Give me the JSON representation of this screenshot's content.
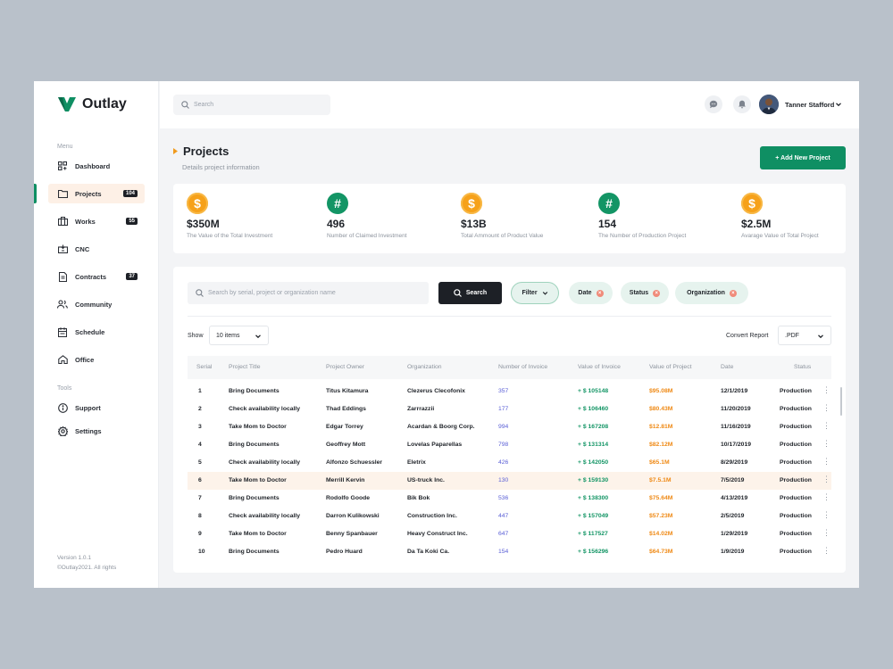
{
  "brand": {
    "name": "Outlay",
    "color": "#0f8f63"
  },
  "sidebar": {
    "menu_label": "Menu",
    "tools_label": "Tools",
    "items": [
      {
        "label": "Dashboard",
        "icon": "dashboard-icon"
      },
      {
        "label": "Projects",
        "icon": "folder-icon",
        "badge": "104",
        "active": true
      },
      {
        "label": "Works",
        "icon": "briefcase-icon",
        "badge": "55"
      },
      {
        "label": "CNC",
        "icon": "cnc-icon"
      },
      {
        "label": "Contracts",
        "icon": "document-icon",
        "badge": "37"
      },
      {
        "label": "Community",
        "icon": "users-icon"
      },
      {
        "label": "Schedule",
        "icon": "calendar-icon"
      },
      {
        "label": "Office",
        "icon": "home-icon"
      }
    ],
    "tools": [
      {
        "label": "Support",
        "icon": "info-icon"
      },
      {
        "label": "Settings",
        "icon": "gear-icon"
      }
    ],
    "version": "Version 1.0.1",
    "copyright": "©Outlay2021. All rights"
  },
  "topbar": {
    "search_placeholder": "Search",
    "user_name": "Tanner Stafford"
  },
  "page": {
    "title": "Projects",
    "subtitle": "Details project information",
    "add_button": "+ Add New Project"
  },
  "stats": [
    {
      "icon": "dollar-icon",
      "symbol": "$",
      "value": "$350M",
      "label": "The Value of the Total Investment"
    },
    {
      "icon": "hash-icon",
      "symbol": "#",
      "value": "496",
      "label": "Number of Claimed Investment"
    },
    {
      "icon": "dollar-icon",
      "symbol": "$",
      "value": "$13B",
      "label": "Total Ammount of Product Value"
    },
    {
      "icon": "hash-icon",
      "symbol": "#",
      "value": "154",
      "label": "The Number of Production Project"
    },
    {
      "icon": "dollar-icon",
      "symbol": "$",
      "value": "$2.5M",
      "label": "Avarage Value of Total Project"
    }
  ],
  "filters": {
    "search_placeholder": "Search by serial, project or organization name",
    "search_button": "Search",
    "filter_button": "Filter",
    "chips": [
      "Date",
      "Status",
      "Organization"
    ],
    "show_label": "Show",
    "show_value": "10 items",
    "convert_label": "Convert Report",
    "convert_value": ".PDF"
  },
  "table": {
    "columns": [
      "Serial",
      "Project Title",
      "Project Owner",
      "Organization",
      "Number of Invoice",
      "Value of Invoice",
      "Value of Project",
      "Date",
      "Status"
    ],
    "rows": [
      [
        "1",
        "Bring Documents",
        "Titus Kitamura",
        "Clezerus Clecofonix",
        "357",
        "+ $ 105148",
        "$95.08M",
        "12/1/2019",
        "Production"
      ],
      [
        "2",
        "Check availability locally",
        "Thad Eddings",
        "Zarrrazzii",
        "177",
        "+ $ 106460",
        "$80.43M",
        "11/20/2019",
        "Production"
      ],
      [
        "3",
        "Take Mom to Doctor",
        "Edgar Torrey",
        "Acardan & Boorg Corp.",
        "994",
        "+ $ 167208",
        "$12.81M",
        "11/16/2019",
        "Production"
      ],
      [
        "4",
        "Bring Documents",
        "Geoffrey Mott",
        "Lovelas Paparellas",
        "798",
        "+ $ 131314",
        "$82.12M",
        "10/17/2019",
        "Production"
      ],
      [
        "5",
        "Check availability locally",
        "Alfonzo Schuessler",
        "Eletrix",
        "426",
        "+ $ 142050",
        "$65.1M",
        "8/29/2019",
        "Production"
      ],
      [
        "6",
        "Take Mom to Doctor",
        "Merrill Kervin",
        "US-truck Inc.",
        "130",
        "+ $ 159130",
        "$7.5.1M",
        "7/5/2019",
        "Production"
      ],
      [
        "7",
        "Bring Documents",
        "Rodolfo Goode",
        "Bik Bok",
        "536",
        "+ $ 138300",
        "$75.64M",
        "4/13/2019",
        "Production"
      ],
      [
        "8",
        "Check availability locally",
        "Darron Kulikowski",
        "Construction Inc.",
        "447",
        "+ $ 157049",
        "$57.23M",
        "2/5/2019",
        "Production"
      ],
      [
        "9",
        "Take Mom to Doctor",
        "Benny Spanbauer",
        "Heavy Construct Inc.",
        "647",
        "+ $ 117527",
        "$14.02M",
        "1/29/2019",
        "Production"
      ],
      [
        "10",
        "Bring Documents",
        "Pedro Huard",
        "Da Ta Koki Ca.",
        "154",
        "+ $ 156296",
        "$64.73M",
        "1/9/2019",
        "Production"
      ]
    ],
    "highlighted_row": 6
  }
}
